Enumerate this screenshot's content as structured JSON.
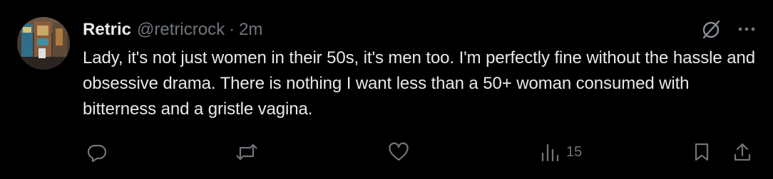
{
  "author": {
    "name": "Retric",
    "handle": "@retricrock",
    "separator": "·",
    "time": "2m"
  },
  "tweet": {
    "text": "Lady, it's not just women in their 50s, it's men too. I'm perfectly fine without the hassle and obsessive drama. There is nothing I want less than a 50+ woman consumed with bitterness and a gristle vagina."
  },
  "actions": {
    "views_count": "15"
  },
  "icons": {
    "grok": "grok-slash-icon",
    "more": "more-dots-icon",
    "reply": "reply-icon",
    "retweet": "retweet-icon",
    "like": "like-heart-icon",
    "views": "views-bars-icon",
    "bookmark": "bookmark-icon",
    "share": "share-icon"
  },
  "colors": {
    "background": "#000000",
    "text_primary": "#e7e9ea",
    "text_secondary": "#71767b"
  }
}
